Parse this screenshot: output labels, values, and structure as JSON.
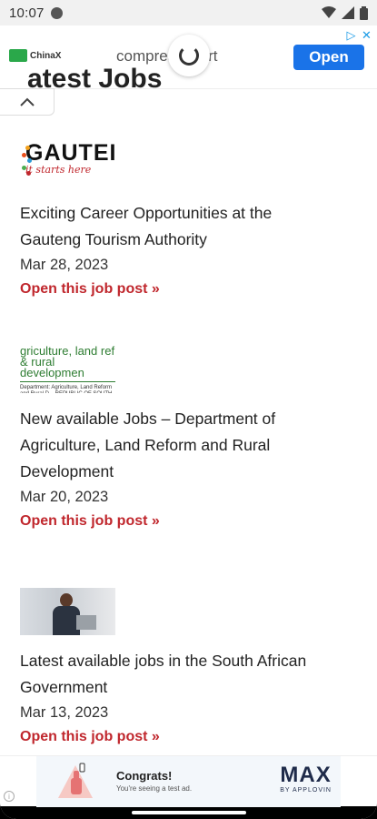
{
  "status_bar": {
    "time": "10:07"
  },
  "top_ad": {
    "brand": "ChinaX",
    "query": "compres   t shirt",
    "cta": "Open"
  },
  "heading_peek": "atest Jobs",
  "jobs": [
    {
      "logo_word": "GAUTEI",
      "logo_tagline": "it starts here",
      "title_line1": "Exciting Career Opportunities at the",
      "title_line2": "Gauteng Tourism Authority",
      "date": "Mar 28, 2023",
      "link": "Open this job post »"
    },
    {
      "logo_line1": "griculture, land ref",
      "logo_line2": "& rural developmen",
      "logo_line3": "Department: Agriculture, Land Reform and Rural D... REPUBLIC OF SOUTH AFRICA",
      "title_line1": "New available Jobs – Department of",
      "title_line2": "Agriculture, Land Reform and Rural",
      "title_line3": "Development",
      "date": "Mar 20, 2023",
      "link": "Open this job post »"
    },
    {
      "title_line1": "Latest available jobs in the South African",
      "title_line2": "Government",
      "date": "Mar 13, 2023",
      "link": "Open this job post »"
    }
  ],
  "bottom_ad": {
    "headline": "Congrats!",
    "subtext": "You're seeing a test ad.",
    "brand": "MAX",
    "brand_sub": "BY APPLOVIN"
  },
  "colors": {
    "link": "#c0272d",
    "cta": "#1a73e8",
    "agri_green": "#2e7d32"
  }
}
